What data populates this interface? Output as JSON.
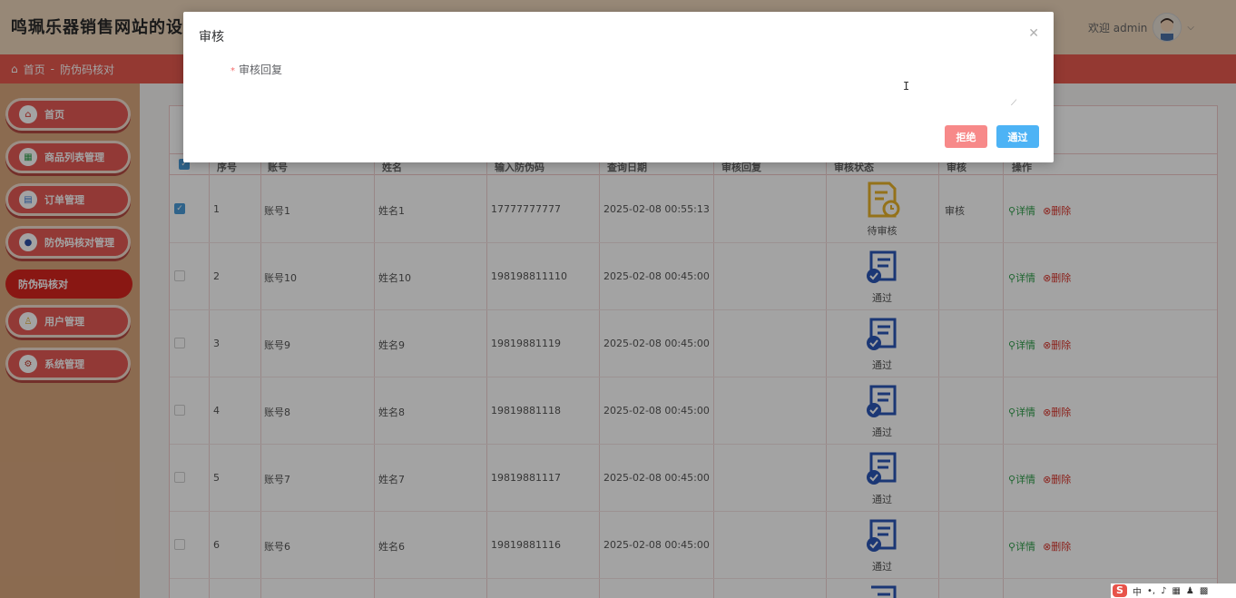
{
  "header": {
    "site_title": "鸣珮乐器销售网站的设",
    "welcome": "欢迎 admin"
  },
  "breadcrumb": {
    "home": "首页",
    "separator": "-",
    "current": "防伪码核对"
  },
  "sidebar": {
    "items": [
      {
        "label": "首页",
        "icon": "home-icon"
      },
      {
        "label": "商品列表管理",
        "icon": "grid-icon"
      },
      {
        "label": "订单管理",
        "icon": "order-icon"
      },
      {
        "label": "防伪码核对管理",
        "icon": "verify-icon"
      },
      {
        "label": "防伪码核对",
        "active": true
      },
      {
        "label": "用户管理",
        "icon": "user-icon"
      },
      {
        "label": "系统管理",
        "icon": "settings-icon"
      }
    ]
  },
  "table": {
    "headers": [
      "序号",
      "账号",
      "姓名",
      "输入防伪码",
      "查询日期",
      "审核回复",
      "审核状态",
      "审核",
      "操作"
    ],
    "rows": [
      {
        "index": "1",
        "account": "账号1",
        "name": "姓名1",
        "code": "17777777777",
        "date": "2025-02-08 00:55:13",
        "reply": "",
        "status": "待审核",
        "audit": "审核",
        "checked": true
      },
      {
        "index": "2",
        "account": "账号10",
        "name": "姓名10",
        "code": "198198811110",
        "date": "2025-02-08 00:45:00",
        "reply": "",
        "status": "通过",
        "audit": "",
        "checked": false
      },
      {
        "index": "3",
        "account": "账号9",
        "name": "姓名9",
        "code": "19819881119",
        "date": "2025-02-08 00:45:00",
        "reply": "",
        "status": "通过",
        "audit": "",
        "checked": false
      },
      {
        "index": "4",
        "account": "账号8",
        "name": "姓名8",
        "code": "19819881118",
        "date": "2025-02-08 00:45:00",
        "reply": "",
        "status": "通过",
        "audit": "",
        "checked": false
      },
      {
        "index": "5",
        "account": "账号7",
        "name": "姓名7",
        "code": "19819881117",
        "date": "2025-02-08 00:45:00",
        "reply": "",
        "status": "通过",
        "audit": "",
        "checked": false
      },
      {
        "index": "6",
        "account": "账号6",
        "name": "姓名6",
        "code": "19819881116",
        "date": "2025-02-08 00:45:00",
        "reply": "",
        "status": "通过",
        "audit": "",
        "checked": false
      }
    ],
    "op_detail": "详情",
    "op_delete": "删除"
  },
  "modal": {
    "title": "审核",
    "field_label": "审核回复",
    "required_mark": "*",
    "reply_value": "",
    "reject_label": "拒绝",
    "pass_label": "通过"
  },
  "ime": {
    "logo": "S",
    "mode": "中"
  },
  "colors": {
    "accent": "#e8594f",
    "sidebar_bg": "#d9a87e",
    "menu_pill": "#e45a55",
    "menu_active": "#d7251f",
    "btn_reject": "#f78989",
    "btn_pass": "#4db3f5",
    "detail_green": "#2e9e4a",
    "delete_red": "#d9342b"
  }
}
